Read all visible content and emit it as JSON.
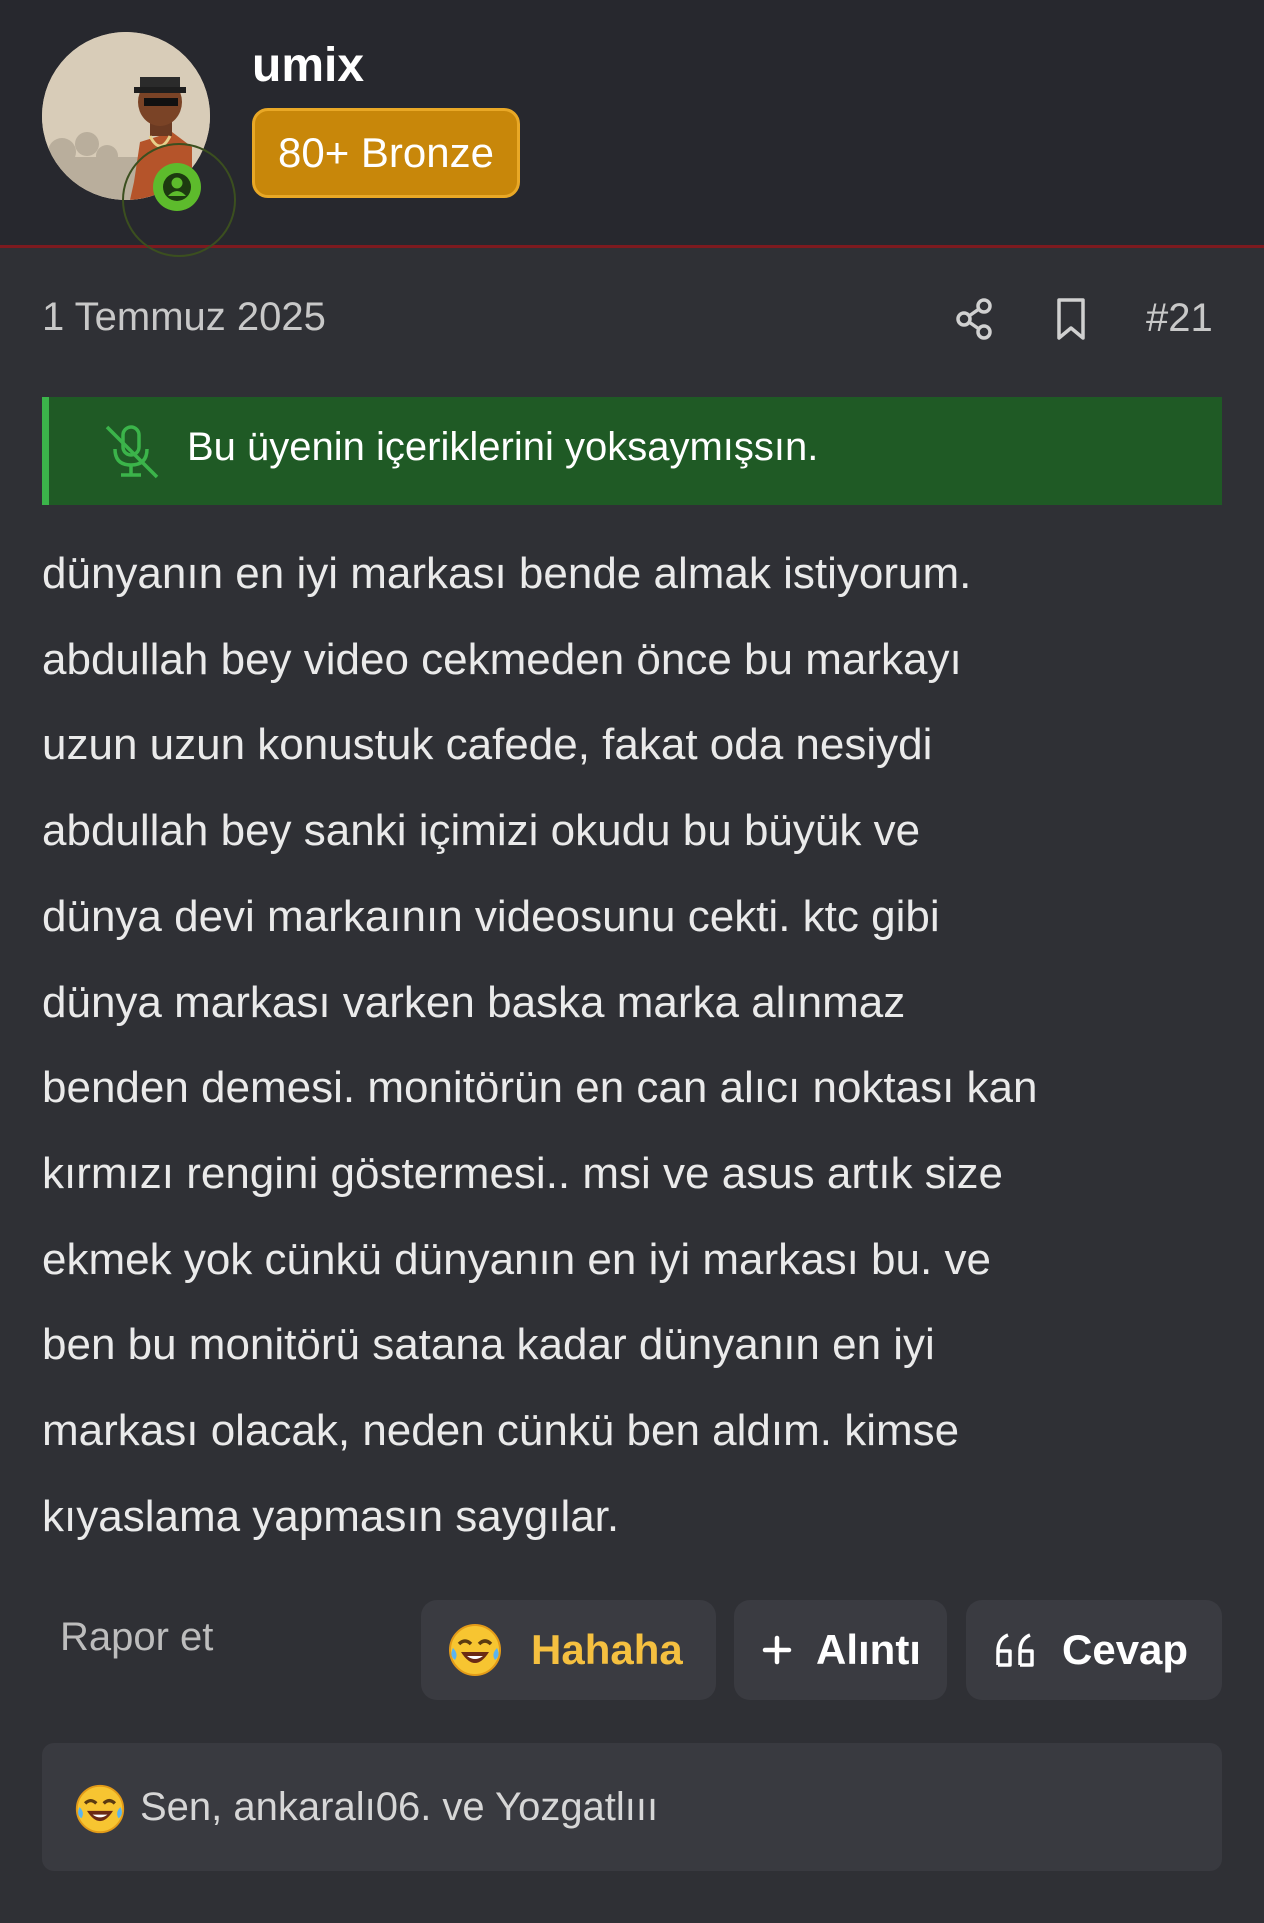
{
  "author": {
    "username": "umix",
    "badge": "80+ Bronze"
  },
  "post": {
    "date": "1 Temmuz 2025",
    "number": "#21",
    "ignore_notice": "Bu üyenin içeriklerini yoksaymışsın.",
    "body_lines": [
      "dünyanın en iyi markası bende almak istiyorum.",
      "abdullah bey video cekmeden önce bu markayı",
      "uzun uzun konustuk cafede, fakat oda nesiydi",
      "abdullah bey sanki içimizi okudu bu büyük ve",
      "dünya devi markaının videosunu cekti. ktc gibi",
      "dünya markası varken baska marka alınmaz",
      "benden demesi. monitörün en can alıcı noktası kan",
      "kırmızı rengini göstermesi.. msi ve asus artık size",
      "ekmek yok cünkü dünyanın en iyi markası bu. ve",
      "ben bu monitörü satana kadar dünyanın en iyi",
      "markası olacak, neden cünkü ben aldım. kimse",
      "kıyaslama yapmasın saygılar."
    ]
  },
  "actions": {
    "report": "Rapor et",
    "haha": "Hahaha",
    "quote": "Alıntı",
    "reply": "Cevap"
  },
  "reactions": {
    "summary": "Sen, ankaralı06. ve Yozgatlııı"
  },
  "icons": {
    "online": "user-online-icon",
    "share": "share-icon",
    "bookmark": "bookmark-icon",
    "ignore": "mic-muted-icon",
    "haha": "laughing-emoji-icon",
    "quote": "plus-icon",
    "reply": "quote-marks-icon"
  },
  "colors": {
    "background": "#2f3035",
    "header": "#27282e",
    "header_border": "#7d1a1f",
    "badge": "#c8870a",
    "ignore_bar": "#1f5a25",
    "ignore_accent": "#3bb44a",
    "haha_text": "#f5c040",
    "online": "#5dbb2c"
  }
}
